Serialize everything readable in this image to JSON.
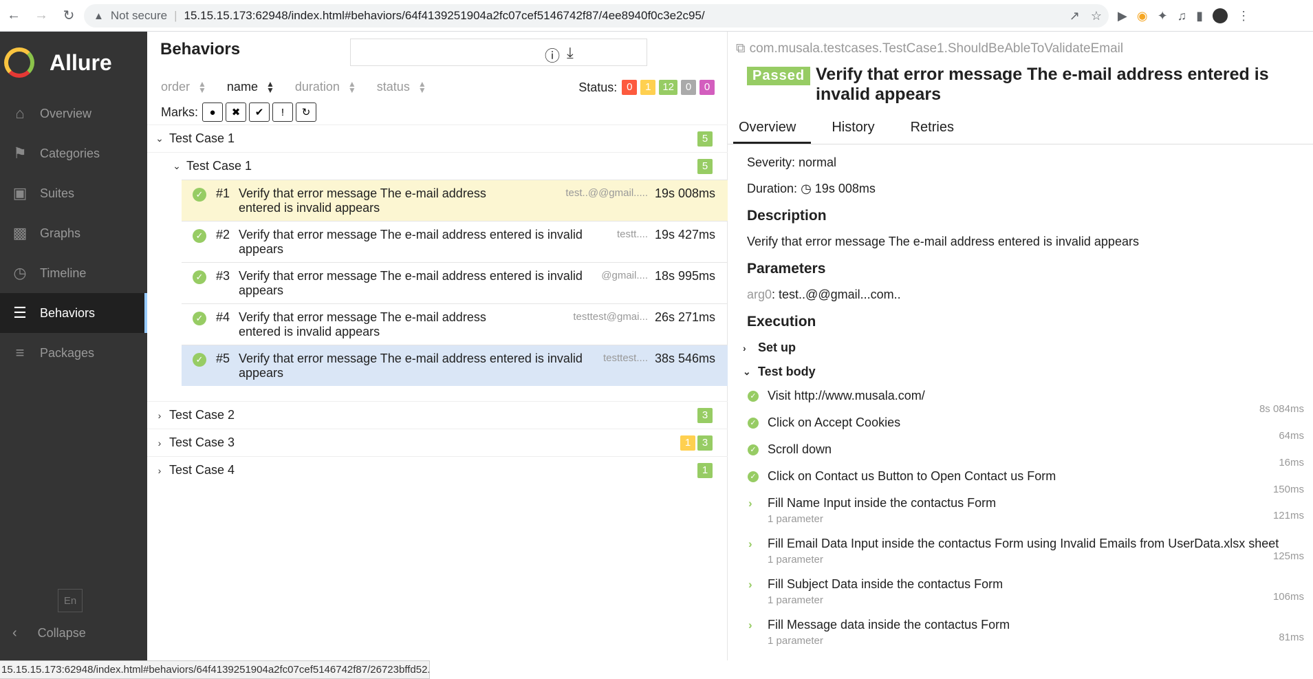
{
  "browser": {
    "security": "Not secure",
    "url": "15.15.15.173:62948/index.html#behaviors/64f4139251904a2fc07cef5146742f87/4ee8940f0c3e2c95/",
    "status_url": "15.15.15.173:62948/index.html#behaviors/64f4139251904a2fc07cef5146742f87/26723bffd52..."
  },
  "sidebar": {
    "brand": "Allure",
    "items": [
      {
        "label": "Overview",
        "icon": "home-icon"
      },
      {
        "label": "Categories",
        "icon": "flag-icon"
      },
      {
        "label": "Suites",
        "icon": "briefcase-icon"
      },
      {
        "label": "Graphs",
        "icon": "bar-chart-icon"
      },
      {
        "label": "Timeline",
        "icon": "clock-icon"
      },
      {
        "label": "Behaviors",
        "icon": "list-icon"
      },
      {
        "label": "Packages",
        "icon": "align-left-icon"
      }
    ],
    "lang": "En",
    "collapse": "Collapse"
  },
  "behaviors": {
    "title": "Behaviors",
    "sorters": [
      "order",
      "name",
      "duration",
      "status"
    ],
    "status_label": "Status:",
    "status_counts": {
      "failed": "0",
      "broken": "1",
      "passed": "12",
      "skipped": "0",
      "unknown": "0"
    },
    "marks_label": "Marks:",
    "groups": [
      {
        "name": "Test Case 1",
        "passed": "5"
      },
      {
        "name": "Test Case 1",
        "passed": "5"
      },
      {
        "name": "Test Case 2",
        "passed": "3"
      },
      {
        "name": "Test Case 3",
        "broken": "1",
        "passed": "3"
      },
      {
        "name": "Test Case 4",
        "passed": "1"
      }
    ],
    "tests": [
      {
        "num": "#1",
        "name": "Verify that error message The e-mail address entered is invalid appears",
        "param": "test..@@gmail.....",
        "duration": "19s 008ms"
      },
      {
        "num": "#2",
        "name": "Verify that error message The e-mail address entered is invalid appears",
        "param": "testt....",
        "duration": "19s 427ms"
      },
      {
        "num": "#3",
        "name": "Verify that error message The e-mail address entered is invalid appears",
        "param": "@gmail....",
        "duration": "18s 995ms"
      },
      {
        "num": "#4",
        "name": "Verify that error message The e-mail address entered is invalid appears",
        "param": "testtest@gmai...",
        "duration": "26s 271ms"
      },
      {
        "num": "#5",
        "name": "Verify that error message The e-mail address entered is invalid appears",
        "param": "testtest....",
        "duration": "38s 546ms"
      }
    ]
  },
  "testcase": {
    "fullname": "com.musala.testcases.TestCase1.ShouldBeAbleToValidateEmail",
    "status": "Passed",
    "title": "Verify that error message The e-mail address entered is invalid appears",
    "tabs": [
      "Overview",
      "History",
      "Retries"
    ],
    "severity": "Severity: normal",
    "duration_label": "Duration:",
    "duration": "19s 008ms",
    "description_h": "Description",
    "description": "Verify that error message The e-mail address entered is invalid appears",
    "parameters_h": "Parameters",
    "param_name": "arg0",
    "param_value": ": test..@@gmail...com..",
    "execution_h": "Execution",
    "setup": "Set up",
    "testbody": "Test body",
    "steps": [
      {
        "name": "Visit http://www.musala.com/",
        "duration": "8s 084ms",
        "type": "ok"
      },
      {
        "name": "Click on Accept Cookies",
        "duration": "64ms",
        "type": "ok"
      },
      {
        "name": "Scroll down",
        "duration": "16ms",
        "type": "ok"
      },
      {
        "name": "Click on Contact us Button to Open Contact us Form",
        "duration": "150ms",
        "type": "ok"
      },
      {
        "name": "Fill Name Input inside the contactus Form",
        "sub": "1 parameter",
        "duration": "121ms",
        "type": "expand"
      },
      {
        "name": "Fill Email Data Input inside the contactus Form using Invalid Emails from UserData.xlsx sheet",
        "sub": "1 parameter",
        "duration": "125ms",
        "type": "expand"
      },
      {
        "name": "Fill Subject Data inside the contactus Form",
        "sub": "1 parameter",
        "duration": "106ms",
        "type": "expand"
      },
      {
        "name": "Fill Message data inside the contactus Form",
        "sub": "1 parameter",
        "duration": "81ms",
        "type": "expand"
      }
    ]
  }
}
